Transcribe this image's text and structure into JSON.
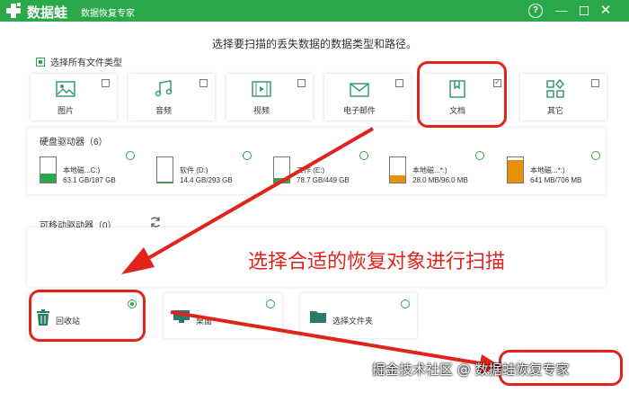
{
  "titlebar": {
    "logo": "数据蛙",
    "subtitle": "数据恢复专家",
    "help": "?",
    "minimize": "—",
    "close": "✕",
    "color": "#2aa84a"
  },
  "heading": "选择要扫描的丢失数据的数据类型和路径。",
  "select_all_label": "选择所有文件类型",
  "file_types": [
    {
      "label": "图片",
      "icon": "image-icon",
      "checked": false
    },
    {
      "label": "音频",
      "icon": "music-icon",
      "checked": false
    },
    {
      "label": "视频",
      "icon": "video-icon",
      "checked": false
    },
    {
      "label": "电子邮件",
      "icon": "email-icon",
      "checked": false
    },
    {
      "label": "文档",
      "icon": "document-icon",
      "checked": true
    },
    {
      "label": "其它",
      "icon": "other-icon",
      "checked": false
    }
  ],
  "hdd_title": "硬盘驱动器（6）",
  "drives": [
    {
      "name": "本地磁...C:)",
      "size": "63.1 GB/187 GB",
      "fill": 0.34,
      "color": "#2aa84a"
    },
    {
      "name": "软件 (D:)",
      "size": "14.4 GB/293 GB",
      "fill": 0.05,
      "color": "#2aa84a"
    },
    {
      "name": "工作 (E:)",
      "size": "78.7 GB/449 GB",
      "fill": 0.18,
      "color": "#2aa84a"
    },
    {
      "name": "本地磁...*:)",
      "size": "28.0 MB/96.0 MB",
      "fill": 0.29,
      "color": "#e8920c"
    },
    {
      "name": "本地磁...*:)",
      "size": "641 MB/706 MB",
      "fill": 0.91,
      "color": "#e8920c"
    }
  ],
  "removable_title": "可移动驱动器（0）",
  "locations": {
    "recycle": "回收站",
    "desktop": "桌面",
    "folder": "选择文件夹"
  },
  "annotation": "选择合适的恢复对象进行扫描",
  "watermark": "掘金技术社区 @ 数据蛙恢复专家",
  "accent_red": "#e0241c"
}
